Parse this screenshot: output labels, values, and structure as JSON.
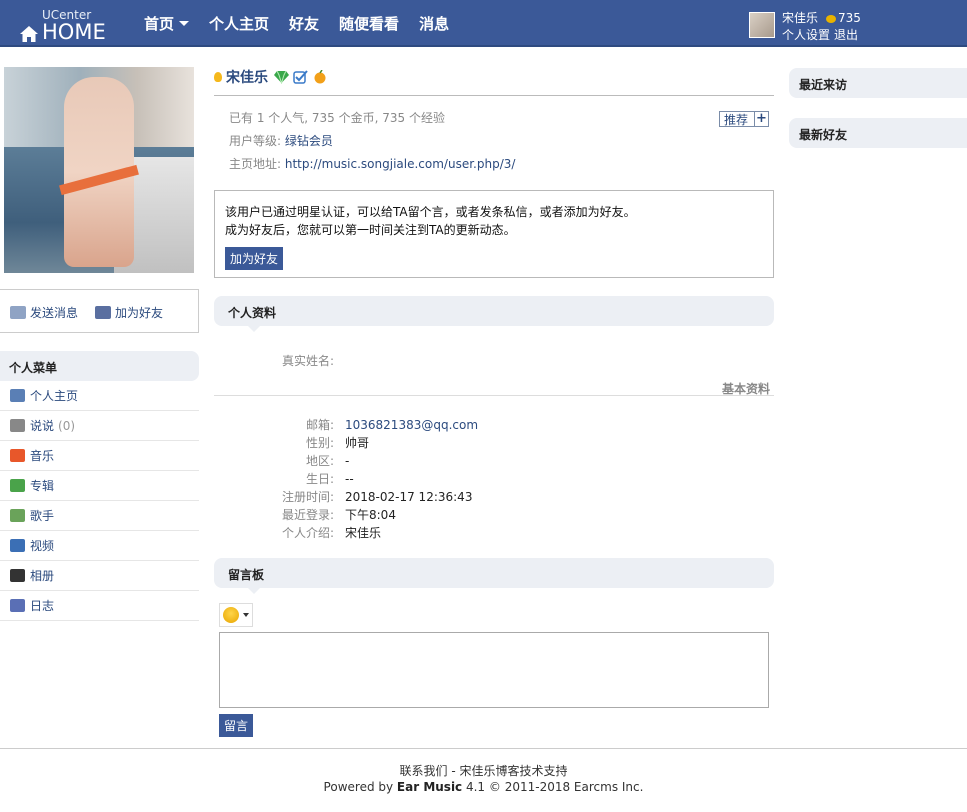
{
  "header": {
    "logo_top": "UCenter",
    "logo_main": "HOME",
    "nav": [
      {
        "label": "首页",
        "dropdown": true
      },
      {
        "label": "个人主页"
      },
      {
        "label": "好友"
      },
      {
        "label": "随便看看"
      },
      {
        "label": "消息"
      }
    ],
    "user": {
      "name": "宋佳乐",
      "coins": "735",
      "settings_link": "个人设置",
      "logout_link": "退出"
    }
  },
  "left": {
    "actions": {
      "send_message": "发送消息",
      "add_friend": "加为好友"
    },
    "menu_title": "个人菜单",
    "menu": [
      {
        "label": "个人主页",
        "icon": "home-icon",
        "color": "#5a7fb5"
      },
      {
        "label": "说说",
        "count": "(0)",
        "icon": "chat-icon",
        "color": "#888888"
      },
      {
        "label": "音乐",
        "icon": "music-icon",
        "color": "#e8572a"
      },
      {
        "label": "专辑",
        "icon": "tv-icon",
        "color": "#4aa34a"
      },
      {
        "label": "歌手",
        "icon": "singer-icon",
        "color": "#6aa35a"
      },
      {
        "label": "视频",
        "icon": "video-icon",
        "color": "#3b6fb5"
      },
      {
        "label": "相册",
        "icon": "camera-icon",
        "color": "#333333"
      },
      {
        "label": "日志",
        "icon": "journal-icon",
        "color": "#5a6fb5"
      }
    ]
  },
  "profile": {
    "name": "宋佳乐",
    "stats": "已有 1 个人气, 735 个金币, 735 个经验",
    "level_label": "用户等级:",
    "level_value": "绿钻会员",
    "homepage_label": "主页地址:",
    "homepage_url": "http://music.songjiale.com/user.php/3/",
    "recommend": "推荐",
    "notice_line1": "该用户已通过明星认证，可以给TA留个言，或者发条私信，或者添加为好友。",
    "notice_line2": "成为好友后，您就可以第一时间关注到TA的更新动态。",
    "add_friend_btn": "加为好友"
  },
  "personal": {
    "title": "个人资料",
    "realname_label": "真实姓名:",
    "basic_label": "基本资料",
    "fields": [
      {
        "label": "邮箱:",
        "value": "1036821383@qq.com",
        "link": true
      },
      {
        "label": "性别:",
        "value": "帅哥"
      },
      {
        "label": "地区:",
        "value": "-"
      },
      {
        "label": "生日:",
        "value": "--"
      },
      {
        "label": "注册时间:",
        "value": "2018-02-17 12:36:43"
      },
      {
        "label": "最近登录:",
        "value": "下午8:04"
      },
      {
        "label": "个人介绍:",
        "value": "宋佳乐"
      }
    ]
  },
  "guestbook": {
    "title": "留言板",
    "submit": "留言"
  },
  "right": {
    "recent_visitors": "最近来访",
    "new_friends": "最新好友"
  },
  "footer": {
    "contact": "联系我们",
    "dash": " - ",
    "support": "宋佳乐博客技术支持",
    "powered_prefix": "Powered by ",
    "product": "Ear Music",
    "version": " 4.1 © 2011-2018 Earcms Inc."
  }
}
